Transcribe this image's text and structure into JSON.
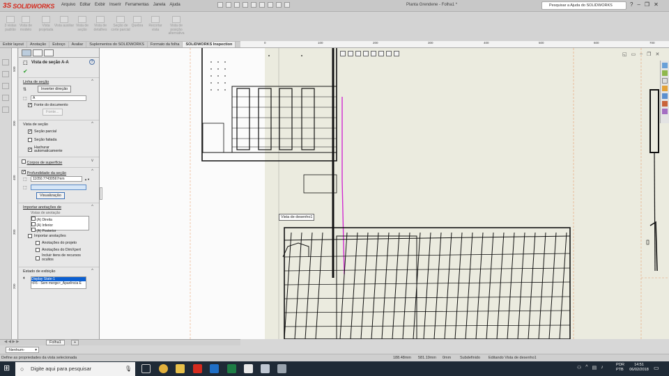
{
  "app": {
    "brand_prefix": "3S",
    "brand": "SOLIDWORKS",
    "document_title": "Planta Grendene - Folha1 *",
    "help_search_placeholder": "Pesquisar a Ajuda do SOLIDWORKS"
  },
  "menus": [
    "Arquivo",
    "Editar",
    "Exibir",
    "Inserir",
    "Ferramentas",
    "Janela",
    "Ajuda"
  ],
  "commands": [
    {
      "label": "3 vistas padrão"
    },
    {
      "label": "Vista de modelo"
    },
    {
      "label": "Vista projetada"
    },
    {
      "label": "Vista auxiliar"
    },
    {
      "label": "Vista de seção"
    },
    {
      "label": "Vista de detalhes"
    },
    {
      "label": "Seção de corte parcial"
    },
    {
      "label": "Quebra"
    },
    {
      "label": "Recortar vista"
    },
    {
      "label": "Vista de posição alternativa"
    }
  ],
  "tabs": [
    "Exibir layout",
    "Anotação",
    "Esboço",
    "Avaliar",
    "Suplementos do SOLIDWORKS",
    "Formato da folha",
    "SOLIDWORKS Inspection"
  ],
  "ruler_top": [
    "0",
    "100",
    "200",
    "300",
    "400",
    "500",
    "600",
    "700"
  ],
  "ruler_left": [
    "500",
    "300",
    "400",
    "300",
    "200",
    "100"
  ],
  "panel": {
    "title": "Vista de seção A-A",
    "section_line": {
      "header": "Linha de seção",
      "flip_button": "Inverter direção",
      "label_value": "A",
      "doc_font_label": "Fonte do documento",
      "font_button": "Fonte..."
    },
    "section_view": {
      "header": "Vista de seção",
      "partial": "Seção parcial",
      "sliced": "Seção fatiada",
      "auto_hatch": "Hachurar automaticamente"
    },
    "surface_bodies": "Corpos de superfície",
    "depth": {
      "header": "Profundidade da seção",
      "value": "11050.77430567mm",
      "preview_button": "Visualização"
    },
    "import_annotations": {
      "header": "Importar anotações de",
      "subheader": "Vistas de anotação",
      "views": [
        "(A) Direita",
        "(A) Inferior",
        "(A) Posterior"
      ],
      "import_label": "Importar anotações",
      "design_annotations": "Anotações do projeto",
      "dimxpert_annotations": "Anotações do DimXpert",
      "hidden_features": "Incluir itens de recursos ocultos"
    },
    "display_state": {
      "header": "Estado de exibição",
      "items": [
        "Display State-1",
        "<F6 - Sem merge>_Aparência E"
      ]
    }
  },
  "sheet_tab": "Folha1",
  "layer_select": "-Nenhum-",
  "canvas": {
    "tooltip": "Vista de desenho1"
  },
  "status": {
    "hint": "Define as propriedades da vista selecionada",
    "x": "188.48mm",
    "y": "581.19mm",
    "z": "0mm",
    "state": "Subdefinido",
    "mode": "Editando Vista de desenho1"
  },
  "taskbar": {
    "search": "Digite aqui para pesquisar",
    "lang1": "POR",
    "lang2": "PTB",
    "time": "14:51",
    "date": "06/02/2018"
  }
}
